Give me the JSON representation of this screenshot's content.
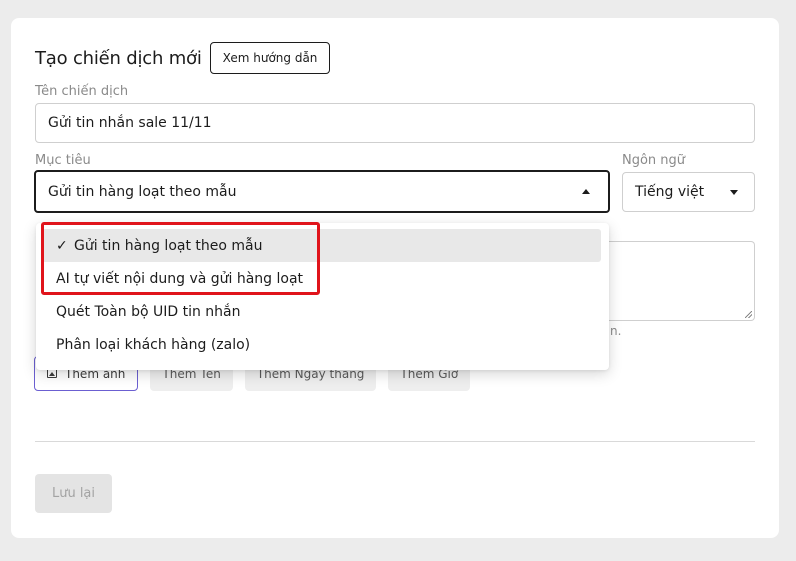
{
  "header": {
    "title": "Tạo chiến dịch mới",
    "guide_button": "Xem hướng dẫn"
  },
  "campaign_name": {
    "label": "Tên chiến dịch",
    "value": "Gửi tin nhắn sale 11/11"
  },
  "goal": {
    "label": "Mục tiêu",
    "value": "Gửi tin hàng loạt theo mẫu",
    "options": [
      {
        "label": "Gửi tin hàng loạt theo mẫu",
        "selected_mark": "✓"
      },
      {
        "label": "AI tự viết nội dung và gửi hàng loạt"
      },
      {
        "label": "Quét Toàn bộ UID tin nhắn"
      },
      {
        "label": "Phân loại khách hàng (zalo)"
      }
    ]
  },
  "language": {
    "label": "Ngôn ngữ",
    "value": "Tiếng việt"
  },
  "helper_tail": "n.",
  "chips": {
    "add_image": "Thêm ảnh",
    "add_name": "Thêm Tên",
    "add_date": "Thêm Ngày tháng",
    "add_hour": "Thêm Giờ"
  },
  "save_button": "Lưu lại",
  "colors": {
    "highlight": "#e0141b",
    "chip_outline": "#6b5fd1",
    "selected_option_bg": "#e8e8e8"
  }
}
